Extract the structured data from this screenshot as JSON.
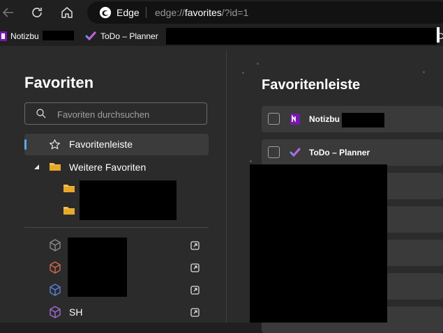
{
  "toolbar": {
    "back_icon": "back-arrow-icon",
    "reload_icon": "reload-icon",
    "home_icon": "home-icon",
    "site_label": "Edge",
    "url_prefix": "edge://",
    "url_host": "favorites",
    "url_rest": "/?id=1"
  },
  "bookmarks_bar": {
    "items": [
      {
        "label": "Notizbu",
        "icon": "onenote-icon"
      },
      {
        "label": "ToDo – Planner",
        "icon": "todo-icon"
      }
    ],
    "overflow_char": "C"
  },
  "sidebar": {
    "title": "Favoriten",
    "search_placeholder": "Favoriten durchsuchen",
    "tree": [
      {
        "label": "Favoritenleiste",
        "icon": "star-icon",
        "selected": true
      },
      {
        "label": "Weitere Favoriten",
        "icon": "folder-icon",
        "expanded": true
      }
    ],
    "other_items": [
      {
        "label": "",
        "icon": "cube-icon",
        "color": "#8a8a8a"
      },
      {
        "label": "",
        "icon": "cube-icon",
        "color": "#d0674f"
      },
      {
        "label": "",
        "icon": "cube-icon",
        "color": "#5b7fd6"
      },
      {
        "label": "SH",
        "icon": "cube-icon",
        "color": "#a26ad0"
      }
    ]
  },
  "main": {
    "title": "Favoritenleiste",
    "rows": [
      {
        "label": "Notizbu",
        "icon": "onenote-icon"
      },
      {
        "label": "ToDo – Planner",
        "icon": "todo-icon"
      }
    ]
  },
  "colors": {
    "accent": "#60a8e6",
    "folder": "#f2c14e",
    "onenote": "#7719aa"
  }
}
